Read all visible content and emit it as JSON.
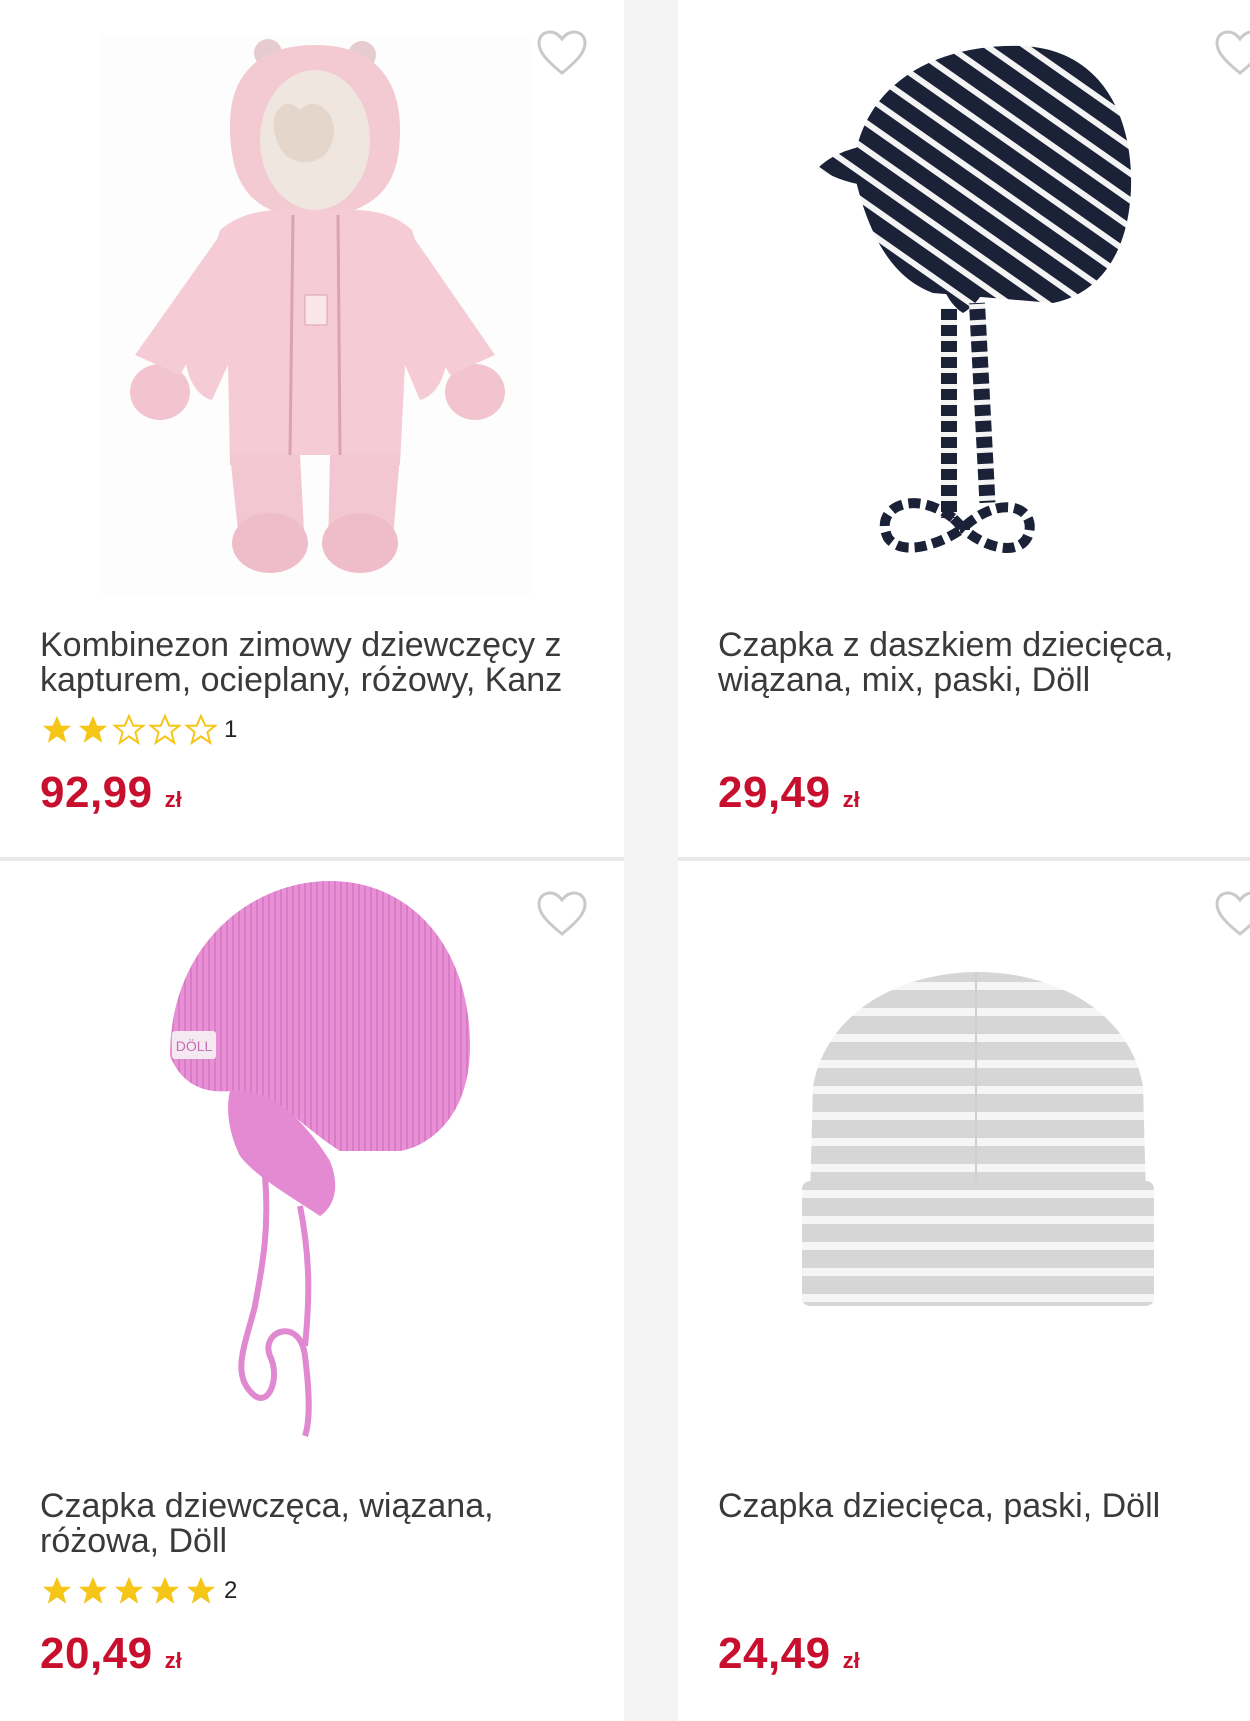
{
  "products": [
    {
      "title": "Kombinezon zimowy dziewczęcy z kapturem, ocieplany, różowy, Kanz",
      "rating": 2,
      "review_count": "1",
      "price": "92,99",
      "currency": "zł",
      "image": "pink-snowsuit"
    },
    {
      "title": "Czapka z daszkiem dziecięca, wiązana, mix, paski, Döll",
      "price": "29,49",
      "currency": "zł",
      "image": "navy-striped-cap"
    },
    {
      "title": "Czapka dziewczęca, wiązana, różowa, Döll",
      "rating": 5,
      "review_count": "2",
      "price": "20,49",
      "currency": "zł",
      "image": "pink-knit-hat"
    },
    {
      "title": "Czapka dziecięca, paski, Döll",
      "price": "24,49",
      "currency": "zł",
      "image": "grey-striped-beanie"
    }
  ],
  "colors": {
    "price": "#c8102e",
    "star": "#f5c518",
    "text": "#3a3a3a"
  }
}
